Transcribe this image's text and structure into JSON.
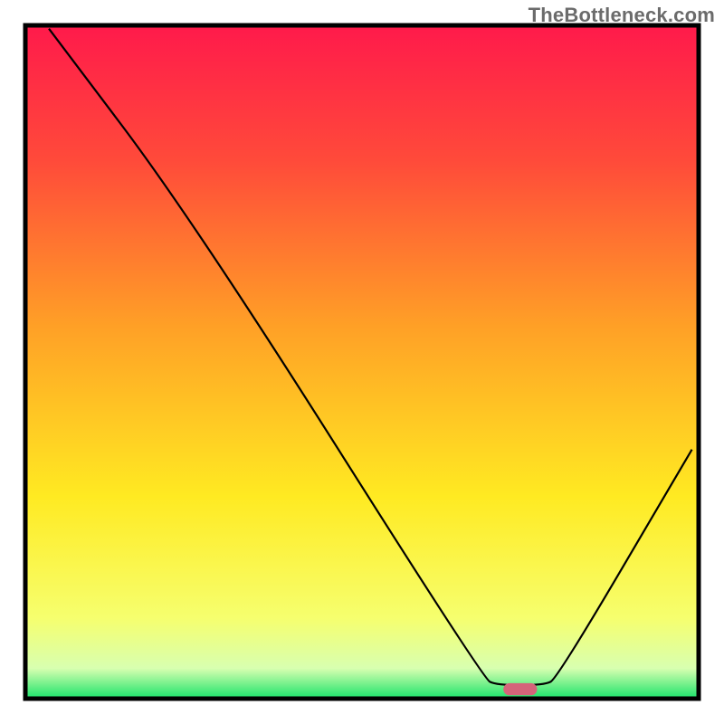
{
  "watermark": "TheBottleneck.com",
  "chart_data": {
    "type": "line",
    "title": "",
    "xlabel": "",
    "ylabel": "",
    "xlim": [
      0,
      100
    ],
    "ylim": [
      0,
      100
    ],
    "grid": false,
    "legend": false,
    "annotations": [],
    "background_gradient_stops": [
      {
        "offset": 0.0,
        "color": "#ff1a4b"
      },
      {
        "offset": 0.2,
        "color": "#ff4a3a"
      },
      {
        "offset": 0.45,
        "color": "#ffa126"
      },
      {
        "offset": 0.7,
        "color": "#ffea22"
      },
      {
        "offset": 0.88,
        "color": "#f6ff6e"
      },
      {
        "offset": 0.955,
        "color": "#d8ffb0"
      },
      {
        "offset": 1.0,
        "color": "#19e36a"
      }
    ],
    "series": [
      {
        "name": "bottleneck-curve",
        "stroke": "#000000",
        "stroke_width": 2.2,
        "points": [
          {
            "x": 3.5,
            "y": 99.5
          },
          {
            "x": 25.0,
            "y": 71.0
          },
          {
            "x": 68.0,
            "y": 3.0
          },
          {
            "x": 70.0,
            "y": 2.0
          },
          {
            "x": 77.0,
            "y": 2.0
          },
          {
            "x": 79.0,
            "y": 3.0
          },
          {
            "x": 99.0,
            "y": 37.0
          }
        ]
      }
    ],
    "marker": {
      "name": "optimal-range",
      "shape": "capsule",
      "fill": "#d5647a",
      "x_center": 73.5,
      "y": 1.4,
      "width_x_units": 5.0,
      "height_y_units": 1.8
    },
    "colors": {
      "axis": "#000000",
      "frame": "#000000"
    },
    "notes": "No axis tick labels or numeric annotations are rendered in the original; x and y are in percent-of-plot-area units (0–100)."
  }
}
